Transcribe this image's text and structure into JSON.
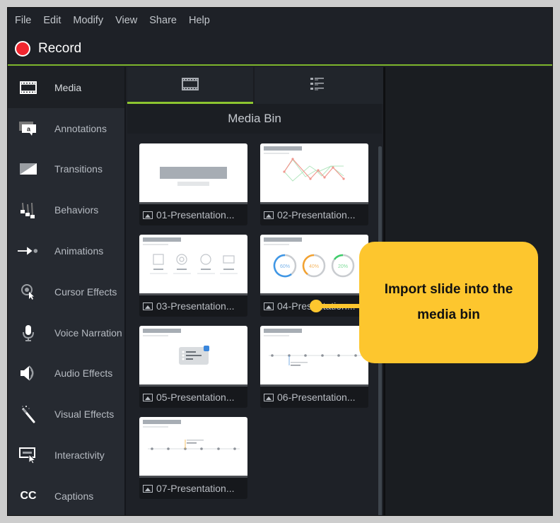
{
  "menu": [
    "File",
    "Edit",
    "Modify",
    "View",
    "Share",
    "Help"
  ],
  "record": {
    "label": "Record",
    "color": "#f0262f"
  },
  "accent_color": "#8dc530",
  "sidebar": {
    "items": [
      {
        "label": "Media",
        "icon": "film-strip-icon",
        "active": true
      },
      {
        "label": "Annotations",
        "icon": "annotation-bubble-icon"
      },
      {
        "label": "Transitions",
        "icon": "transition-icon"
      },
      {
        "label": "Behaviors",
        "icon": "behaviors-icon"
      },
      {
        "label": "Animations",
        "icon": "animation-arrow-icon"
      },
      {
        "label": "Cursor Effects",
        "icon": "cursor-effects-icon"
      },
      {
        "label": "Voice Narration",
        "icon": "microphone-icon"
      },
      {
        "label": "Audio Effects",
        "icon": "speaker-icon"
      },
      {
        "label": "Visual Effects",
        "icon": "magic-wand-icon"
      },
      {
        "label": "Interactivity",
        "icon": "interactivity-icon"
      },
      {
        "label": "Captions",
        "icon": "cc-icon",
        "glyph": "CC"
      }
    ]
  },
  "media_panel": {
    "tabs": [
      {
        "name": "thumbnail-view",
        "icon": "film-strip-icon",
        "active": true
      },
      {
        "name": "list-view",
        "icon": "list-details-icon",
        "active": false
      }
    ],
    "title": "Media Bin",
    "items": [
      {
        "label": "01-Presentation...",
        "thumb": "title"
      },
      {
        "label": "02-Presentation...",
        "thumb": "line-chart"
      },
      {
        "label": "03-Presentation...",
        "thumb": "icons"
      },
      {
        "label": "04-Presentation...",
        "thumb": "donuts",
        "donuts": [
          "60%",
          "40%",
          "20%"
        ]
      },
      {
        "label": "05-Presentation...",
        "thumb": "bubble"
      },
      {
        "label": "06-Presentation...",
        "thumb": "timeline"
      },
      {
        "label": "07-Presentation...",
        "thumb": "timeline2"
      }
    ]
  },
  "callout": {
    "text": "Import slide into the media bin",
    "color": "#fdc62e"
  }
}
